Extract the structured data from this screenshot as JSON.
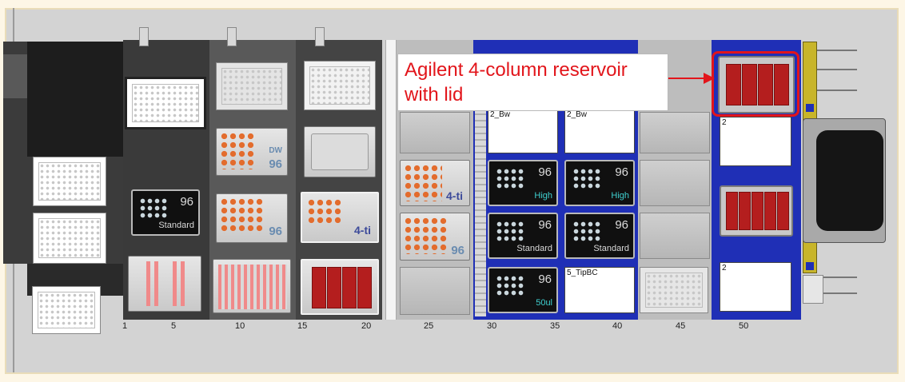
{
  "callout": {
    "text_line1": "Agilent 4-column reservoir",
    "text_line2": "with lid",
    "color": "#e2151b"
  },
  "tracks": {
    "labels": [
      "1",
      "5",
      "10",
      "15",
      "20",
      "25",
      "30",
      "35",
      "40",
      "45",
      "50"
    ]
  },
  "tip_racks": [
    {
      "count": "96",
      "type": "Standard",
      "type_color": "#d9d9d9"
    },
    {
      "count": "96",
      "type": "High",
      "type_color": "#3fd0d0"
    },
    {
      "count": "96",
      "type": "High",
      "type_color": "#3fd0d0"
    },
    {
      "count": "96",
      "type": "Standard",
      "type_color": "#d9d9d9"
    },
    {
      "count": "96",
      "type": "Standard",
      "type_color": "#d9d9d9"
    },
    {
      "count": "96",
      "type": "50ul",
      "type_color": "#3fd0d0"
    }
  ],
  "plate_labels": {
    "dw": "DW",
    "dw_count": "96",
    "plate_96": "96",
    "ti_1": "4-ti",
    "ti_2": "4-ti",
    "plate_96_b": "96"
  },
  "white_boxes": {
    "box1": "2_Bw",
    "box2": "2_Bw",
    "box3": "5_TipBC",
    "box4": "2",
    "box5": "2"
  },
  "colors": {
    "deck_blue": "#1f2fb6",
    "reservoir_red": "#b41e1e",
    "highlight": "#e2151b"
  }
}
